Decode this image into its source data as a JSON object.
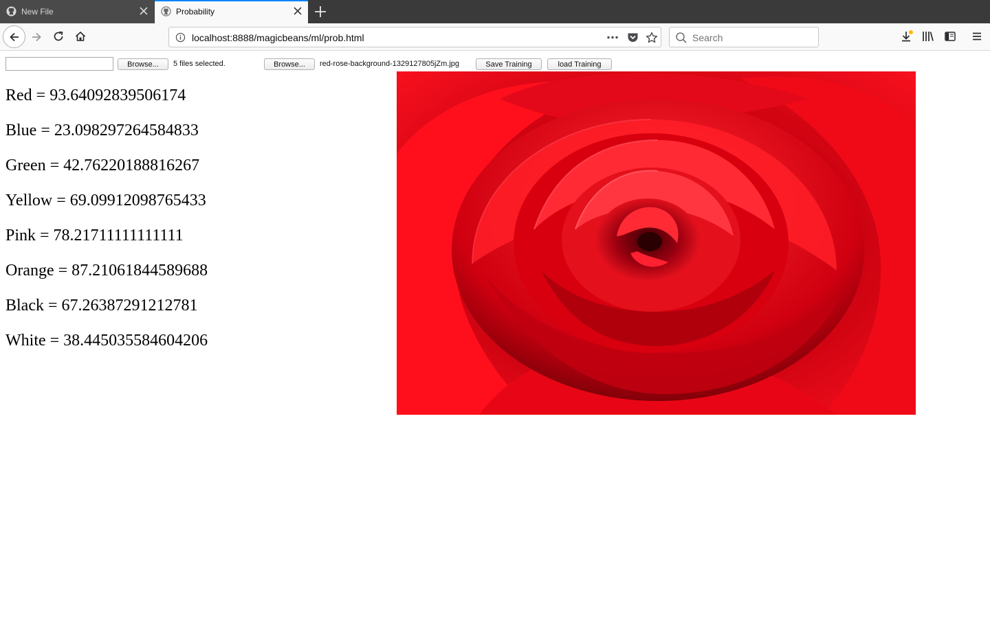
{
  "browser": {
    "tabs": [
      {
        "label": "New File",
        "active": false,
        "icon": "github-icon"
      },
      {
        "label": "Probability",
        "active": true,
        "icon": "github-icon"
      }
    ],
    "url": "localhost:8888/magicbeans/ml/prob.html",
    "search_placeholder": "Search",
    "accent_color": "#0a84ff"
  },
  "page": {
    "text_input_value": "",
    "browse_label_1": "Browse...",
    "files_selected": "5 files selected.",
    "browse_label_2": "Browse...",
    "file_name": "red-rose-background-1329127805jZm.jpg",
    "save_training_label": "Save Training",
    "load_training_label": "load Training",
    "results": [
      {
        "text": "Red = 93.64092839506174"
      },
      {
        "text": "Blue = 23.098297264584833"
      },
      {
        "text": "Green = 42.76220188816267"
      },
      {
        "text": "Yellow = 69.09912098765433"
      },
      {
        "text": "Pink = 78.21711111111111"
      },
      {
        "text": "Orange = 87.21061844589688"
      },
      {
        "text": "Black = 67.26387291212781"
      },
      {
        "text": "White = 38.445035584604206"
      }
    ]
  }
}
